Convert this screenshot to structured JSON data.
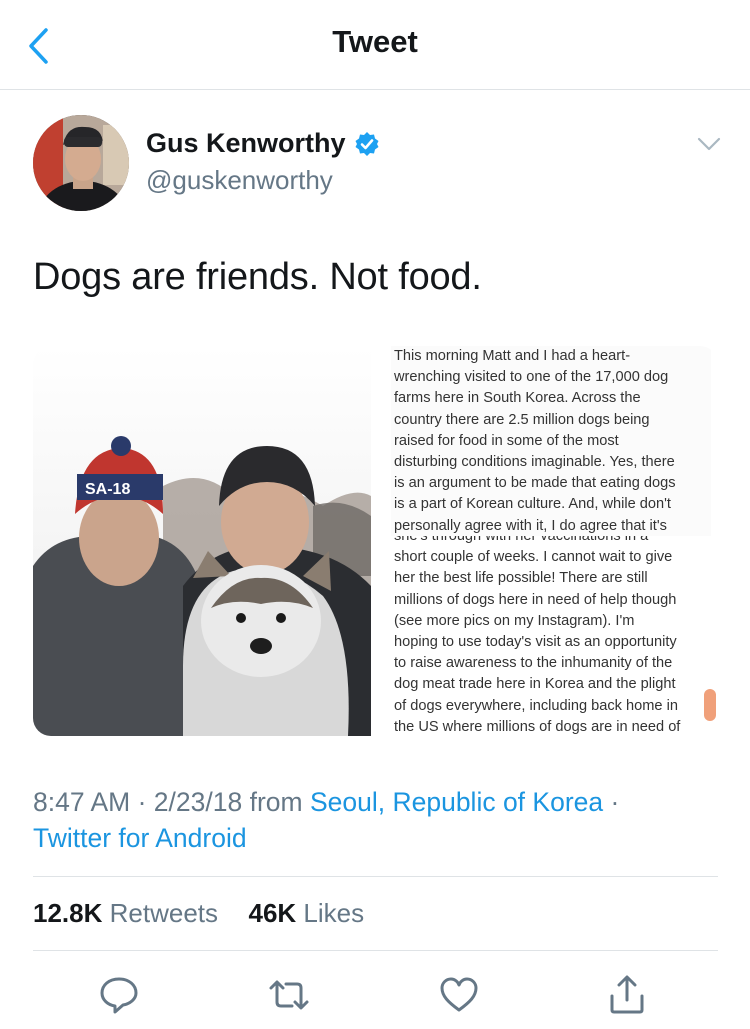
{
  "nav": {
    "title": "Tweet",
    "back_icon": "chevron-left-icon"
  },
  "author": {
    "name": "Gus Kenworthy",
    "handle": "@guskenworthy",
    "verified": true
  },
  "tweet": {
    "text": "Dogs are friends. Not food."
  },
  "note": {
    "top_lines": [
      "This morning Matt and I had a heart-",
      "wrenching visited to one of the 17,000 dog",
      "farms here in South Korea. Across the",
      "country there are 2.5 million dogs being",
      "raised for food in some of the most",
      "disturbing conditions imaginable. Yes, there",
      "is an argument to be made that eating dogs",
      "is a part of Korean culture. And, while don't",
      "personally agree with it, I do agree that it's"
    ],
    "bottom_lines": [
      "she's through with her vaccinations in a",
      "short couple of weeks. I cannot wait to give",
      "her the best life possible! There are still",
      "millions of dogs here in need of help though",
      "(see more pics on my Instagram). I'm",
      "hoping to use today's visit as an opportunity",
      "to raise awareness to the inhumanity of the",
      "dog meat trade here in Korea and the plight",
      "of dogs everywhere, including back home in",
      "the US where millions of dogs are in need of"
    ]
  },
  "meta": {
    "time": "8:47 AM",
    "date": "2/23/18",
    "from_label": "from",
    "location": "Seoul, Republic of Korea",
    "client": "Twitter for Android"
  },
  "stats": {
    "retweets_count": "12.8K",
    "retweets_label": "Retweets",
    "likes_count": "46K",
    "likes_label": "Likes"
  },
  "colors": {
    "link": "#1b95e0",
    "secondary": "#657786",
    "verified": "#1da1f2"
  }
}
